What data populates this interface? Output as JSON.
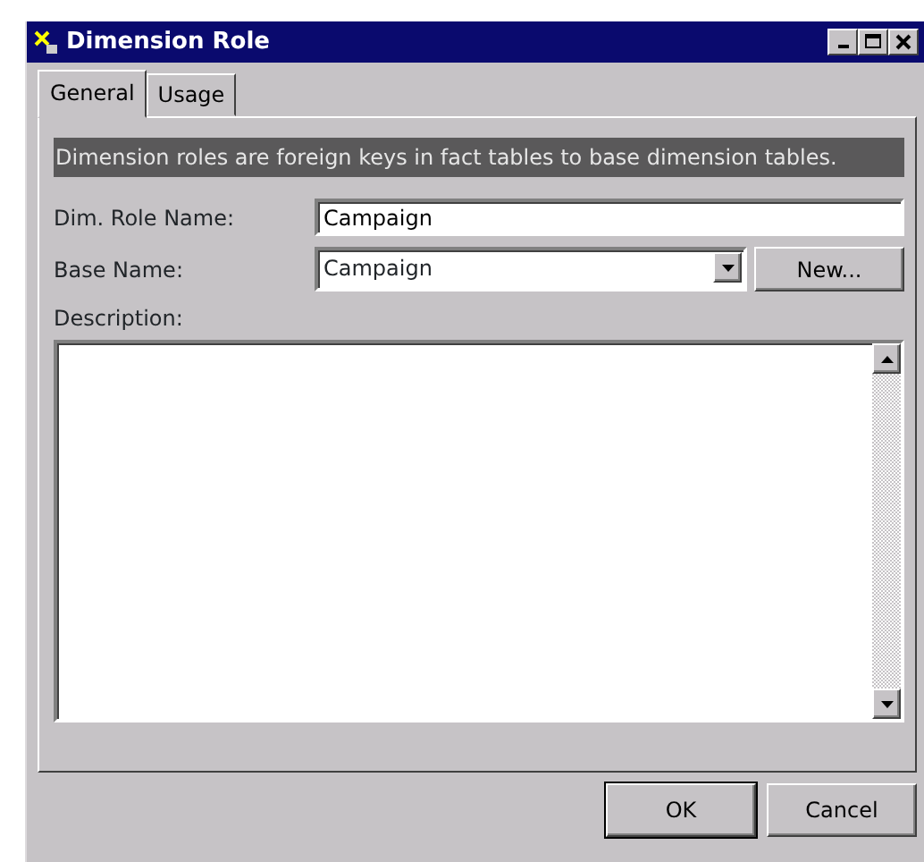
{
  "window": {
    "title": "Dimension Role"
  },
  "tabs": [
    {
      "label": "General",
      "selected": true
    },
    {
      "label": "Usage",
      "selected": false
    }
  ],
  "info_banner": "Dimension roles are foreign keys in fact tables to base dimension tables.",
  "fields": [
    {
      "kind": "text",
      "label": "Dim. Role Name:",
      "value": "Campaign"
    },
    {
      "kind": "combo",
      "label": "Base Name:",
      "value": "Campaign",
      "button": "New..."
    }
  ],
  "description": {
    "label": "Description:"
  },
  "buttons": [
    "OK",
    "Cancel"
  ]
}
